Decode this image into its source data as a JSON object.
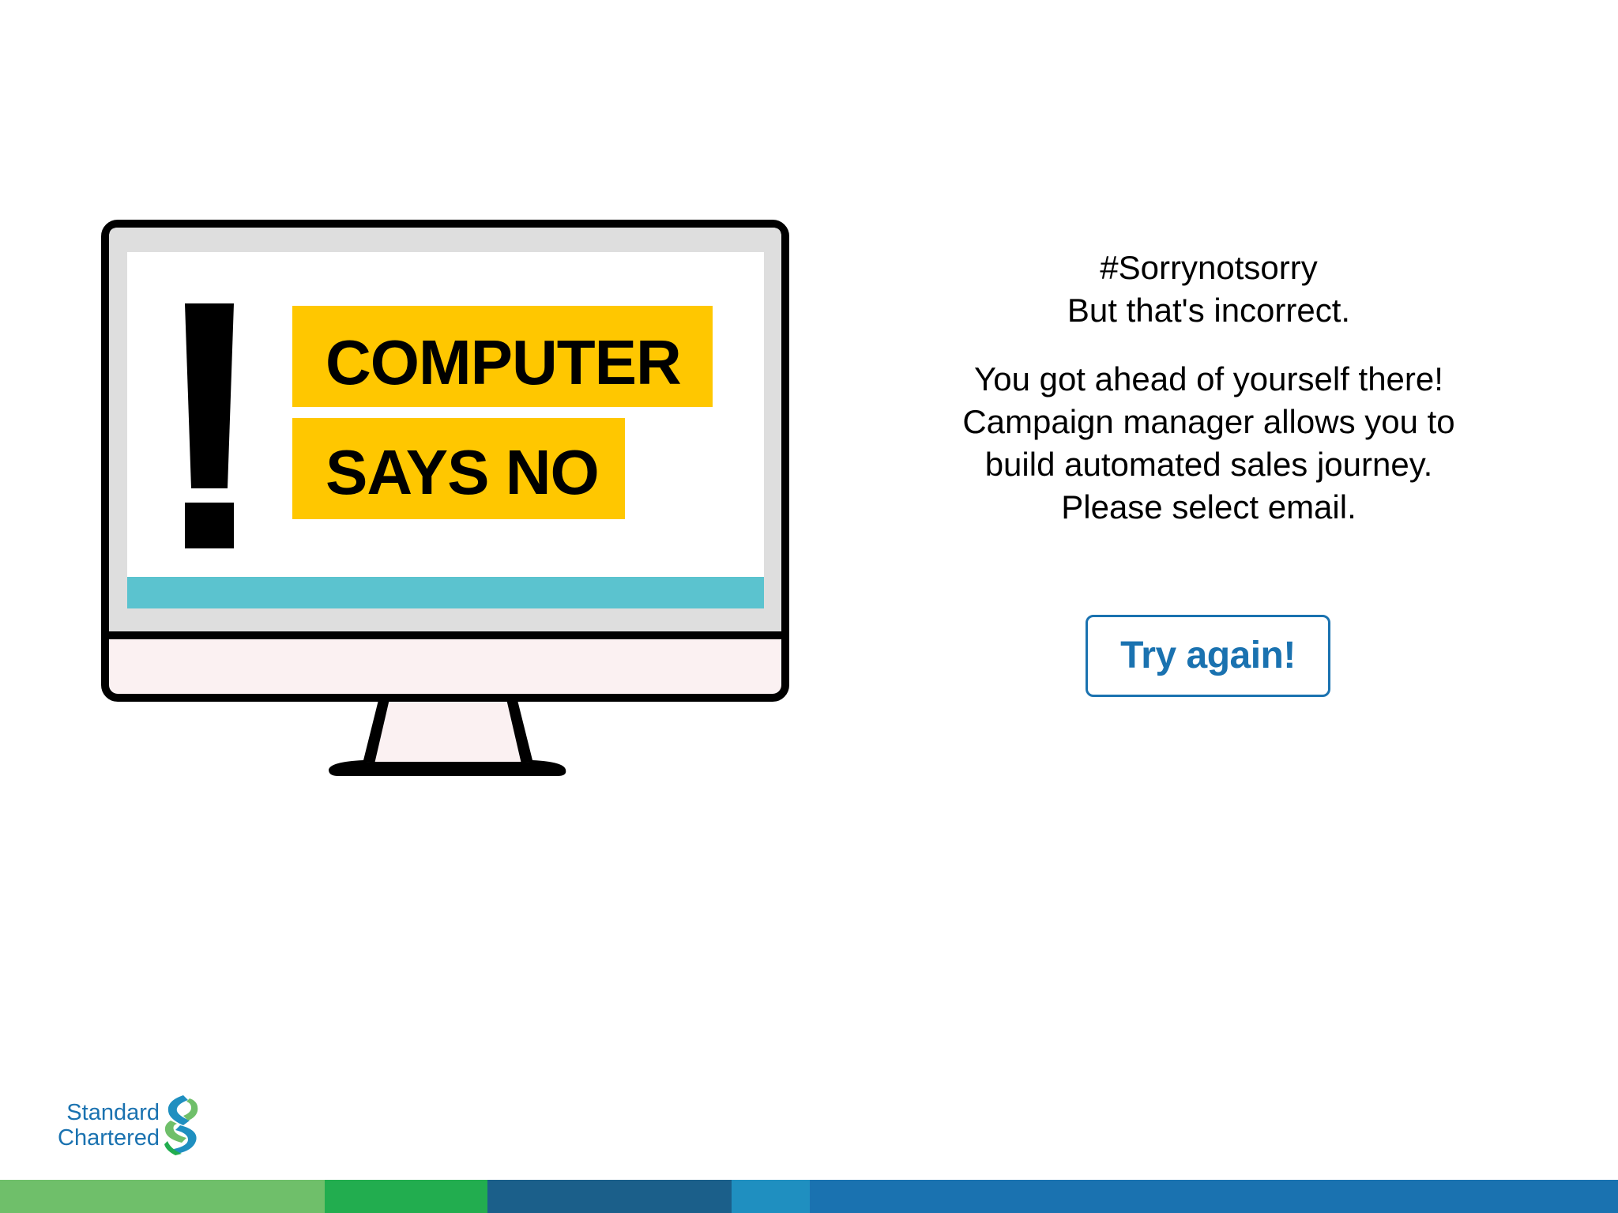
{
  "screen": {
    "label_line1": "COMPUTER",
    "label_line2": "SAYS NO",
    "exclamation_icon": "exclamation-icon",
    "label_color": "#ffc700",
    "progress_bar_color": "#5bc3cf"
  },
  "message": {
    "line1": "#Sorrynotsorry",
    "line2": "But that's incorrect.",
    "line3": "You got ahead of yourself there!",
    "line4": "Campaign manager allows you to",
    "line5": "build automated sales journey.",
    "line6": "Please select email."
  },
  "button": {
    "try_again_label": "Try again!",
    "color": "#1a72b0"
  },
  "logo": {
    "line1": "Standard",
    "line2": "Chartered",
    "icon": "standard-chartered-logo-icon",
    "text_color": "#1a72b0"
  },
  "bottom_bar": {
    "colors": [
      "#6fbf6a",
      "#22ad4f",
      "#1b5f8a",
      "#1f8fc0",
      "#1a72b0"
    ]
  }
}
